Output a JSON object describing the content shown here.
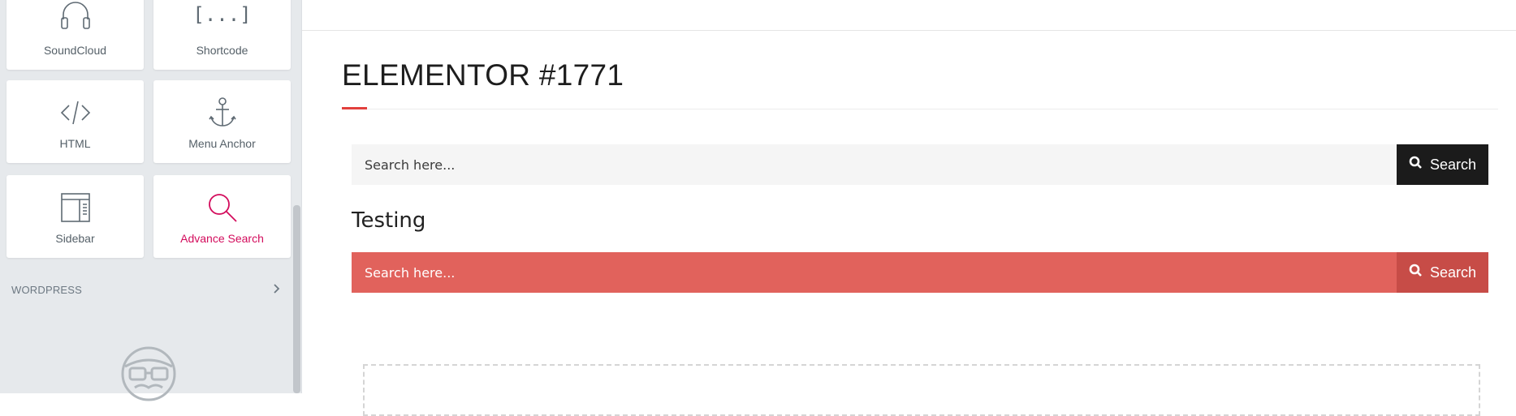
{
  "sidebar": {
    "widgets": [
      {
        "label": "SoundCloud",
        "icon": "headphones-icon"
      },
      {
        "label": "Shortcode",
        "icon": "shortcode-brackets-icon",
        "glyph": "[...]"
      },
      {
        "label": "HTML",
        "icon": "code-icon"
      },
      {
        "label": "Menu Anchor",
        "icon": "anchor-icon"
      },
      {
        "label": "Sidebar",
        "icon": "sidebar-layout-icon"
      },
      {
        "label": "Advance Search",
        "icon": "search-icon",
        "active": true
      }
    ],
    "section": {
      "label": "WORDPRESS",
      "icon": "chevron-right-icon"
    },
    "promo_icon": "nerd-face-icon"
  },
  "preview": {
    "page_title": "ELEMENTOR #1771",
    "search1": {
      "placeholder": "Search here...",
      "button_label": "Search"
    },
    "heading": "Testing",
    "search2": {
      "placeholder": "Search here...",
      "button_label": "Search"
    }
  },
  "colors": {
    "accent_red": "#e2403d",
    "search_bar_red": "#e1625c",
    "search_button_red": "#c74c47",
    "search_button_dark": "#1b1b1b",
    "active_widget": "#d30c5c"
  }
}
